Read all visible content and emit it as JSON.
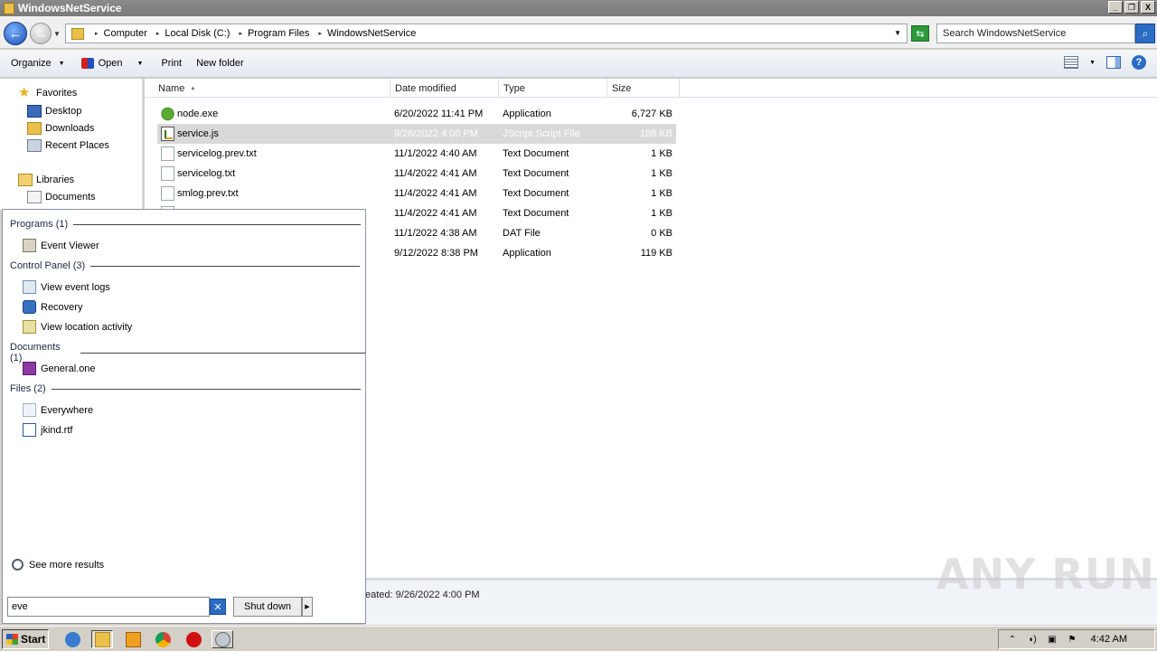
{
  "window": {
    "title": "WindowsNetService",
    "controls": [
      "_",
      "❐",
      "X"
    ]
  },
  "address": {
    "breadcrumbs": [
      "Computer",
      "Local Disk (C:)",
      "Program Files",
      "WindowsNetService"
    ],
    "search_placeholder": "Search WindowsNetService"
  },
  "toolbar": {
    "organize": "Organize",
    "open": "Open",
    "print": "Print",
    "new_folder": "New folder"
  },
  "nav": {
    "favorites": "Favorites",
    "desktop": "Desktop",
    "downloads": "Downloads",
    "recent_places": "Recent Places",
    "libraries": "Libraries",
    "documents": "Documents"
  },
  "columns": {
    "name": "Name",
    "date": "Date modified",
    "type": "Type",
    "size": "Size"
  },
  "files": [
    {
      "name": "node.exe",
      "date": "6/20/2022 11:41 PM",
      "type": "Application",
      "size": "6,727 KB",
      "icon": "app"
    },
    {
      "name": "service.js",
      "date": "9/26/2022 4:00 PM",
      "type": "JScript Script File",
      "size": "188 KB",
      "icon": "js"
    },
    {
      "name": "servicelog.prev.txt",
      "date": "11/1/2022 4:40 AM",
      "type": "Text Document",
      "size": "1 KB",
      "icon": "txt"
    },
    {
      "name": "servicelog.txt",
      "date": "11/4/2022 4:41 AM",
      "type": "Text Document",
      "size": "1 KB",
      "icon": "txt"
    },
    {
      "name": "smlog.prev.txt",
      "date": "11/4/2022 4:41 AM",
      "type": "Text Document",
      "size": "1 KB",
      "icon": "txt"
    },
    {
      "name": "",
      "date": "11/4/2022 4:41 AM",
      "type": "Text Document",
      "size": "1 KB",
      "icon": "txt"
    },
    {
      "name": "",
      "date": "11/1/2022 4:38 AM",
      "type": "DAT File",
      "size": "0 KB",
      "icon": "txt"
    },
    {
      "name": "",
      "date": "9/12/2022 8:38 PM",
      "type": "Application",
      "size": "119 KB",
      "icon": "app"
    }
  ],
  "details": {
    "text": "eated: 9/26/2022 4:00 PM"
  },
  "watermark": "ANY RUN",
  "start_menu": {
    "programs_header": "Programs (1)",
    "event_viewer": "Event Viewer",
    "control_panel_header": "Control Panel (3)",
    "view_event_logs": "View event logs",
    "recovery": "Recovery",
    "view_location_activity": "View location activity",
    "documents_header": "Documents (1)",
    "general_one": "General.one",
    "files_header": "Files (2)",
    "everywhere": "Everywhere",
    "jkind_rtf": "jkind.rtf",
    "see_more": "See more results",
    "search_value": "eve",
    "shut_down": "Shut down"
  },
  "taskbar": {
    "start": "Start",
    "clock": "4:42 AM"
  }
}
